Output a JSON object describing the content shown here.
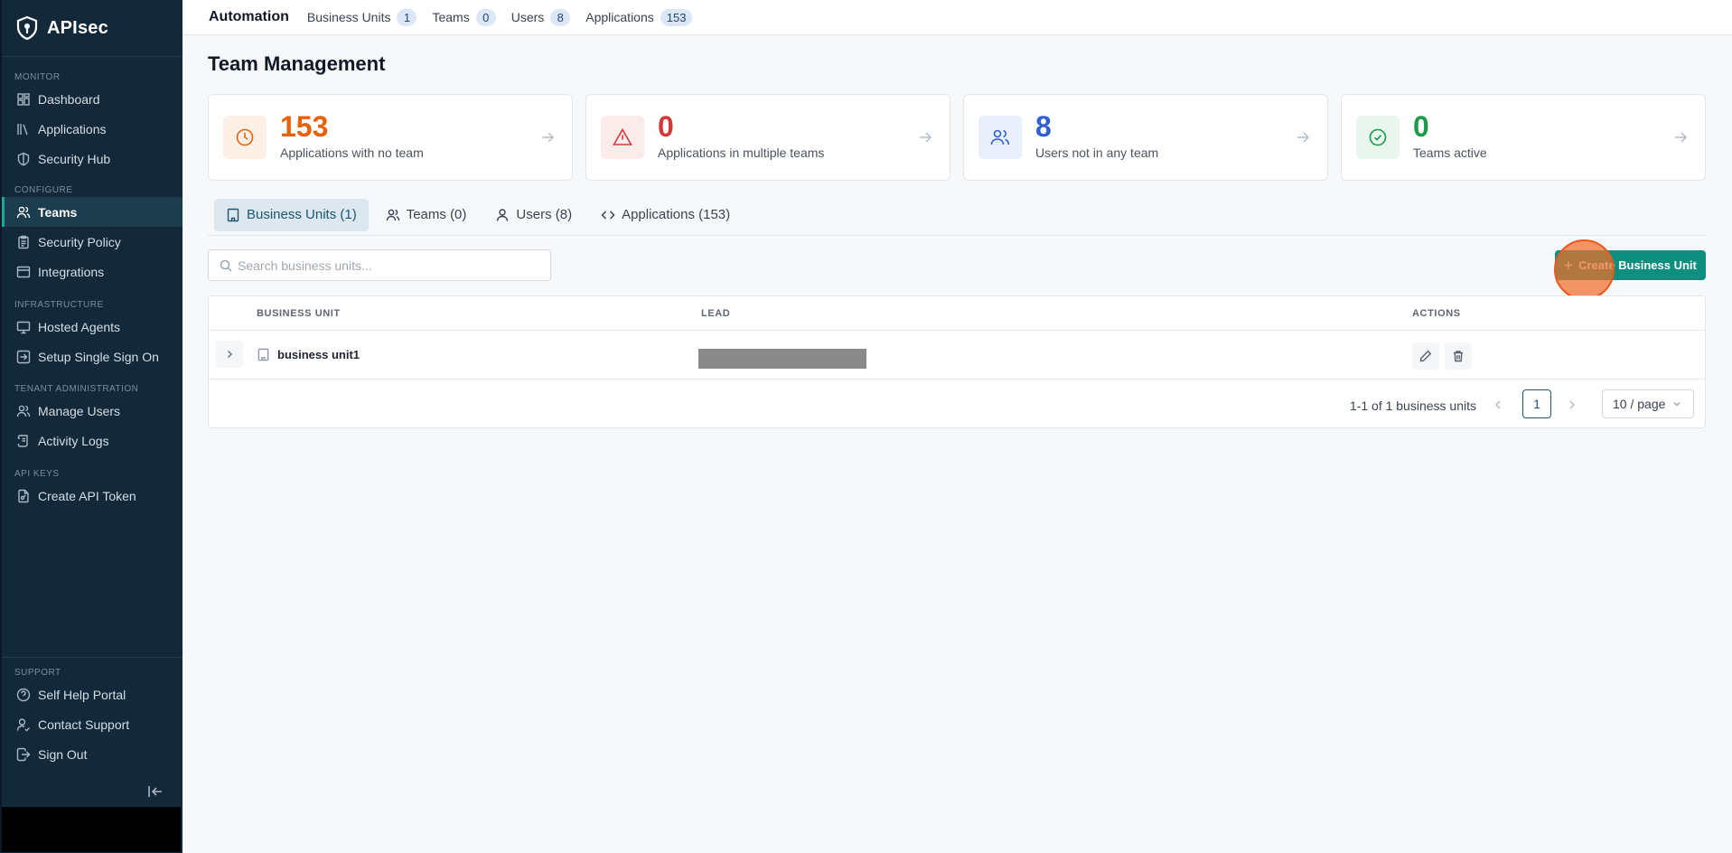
{
  "brand": {
    "name": "APIsec"
  },
  "sidebar": {
    "sections": [
      {
        "label": "MONITOR",
        "items": [
          {
            "label": "Dashboard",
            "icon": "dashboard-icon"
          },
          {
            "label": "Applications",
            "icon": "applications-icon"
          },
          {
            "label": "Security Hub",
            "icon": "shield-icon"
          }
        ]
      },
      {
        "label": "CONFIGURE",
        "items": [
          {
            "label": "Teams",
            "icon": "users-icon",
            "active": true
          },
          {
            "label": "Security Policy",
            "icon": "clipboard-icon"
          },
          {
            "label": "Integrations",
            "icon": "window-icon"
          }
        ]
      },
      {
        "label": "INFRASTRUCTURE",
        "items": [
          {
            "label": "Hosted Agents",
            "icon": "monitor-icon"
          },
          {
            "label": "Setup Single Sign On",
            "icon": "login-icon"
          }
        ]
      },
      {
        "label": "TENANT ADMINISTRATION",
        "items": [
          {
            "label": "Manage Users",
            "icon": "users-icon"
          },
          {
            "label": "Activity Logs",
            "icon": "scroll-icon"
          }
        ]
      },
      {
        "label": "API KEYS",
        "items": [
          {
            "label": "Create API Token",
            "icon": "file-key-icon"
          }
        ]
      }
    ],
    "support": {
      "label": "SUPPORT",
      "items": [
        {
          "label": "Self Help Portal",
          "icon": "help-circle-icon"
        },
        {
          "label": "Contact Support",
          "icon": "contact-icon"
        },
        {
          "label": "Sign Out",
          "icon": "sign-out-icon"
        }
      ]
    }
  },
  "topbar": {
    "title": "Automation",
    "stats": [
      {
        "label": "Business Units",
        "count": "1"
      },
      {
        "label": "Teams",
        "count": "0"
      },
      {
        "label": "Users",
        "count": "8"
      },
      {
        "label": "Applications",
        "count": "153"
      }
    ]
  },
  "page": {
    "title": "Team Management"
  },
  "cards": [
    {
      "value": "153",
      "label": "Applications with no team",
      "icon": "clock-icon",
      "color": "#e8620c",
      "bg": "#fdf0e6"
    },
    {
      "value": "0",
      "label": "Applications in multiple teams",
      "icon": "alert-triangle-icon",
      "color": "#d23a3a",
      "bg": "#fcebeb"
    },
    {
      "value": "8",
      "label": "Users not in any team",
      "icon": "users-icon",
      "color": "#2f5fd0",
      "bg": "#e9f0fc"
    },
    {
      "value": "0",
      "label": "Teams active",
      "icon": "check-circle-icon",
      "color": "#1f9a4c",
      "bg": "#e8f6ee"
    }
  ],
  "tabs": [
    {
      "label": "Business Units (1)",
      "icon": "building-icon",
      "active": true
    },
    {
      "label": "Teams (0)",
      "icon": "users-icon"
    },
    {
      "label": "Users (8)",
      "icon": "user-icon"
    },
    {
      "label": "Applications (153)",
      "icon": "code-icon"
    }
  ],
  "search": {
    "placeholder": "Search business units...",
    "value": ""
  },
  "create_button": {
    "label": "Create Business Unit"
  },
  "table": {
    "columns": [
      "BUSINESS UNIT",
      "LEAD",
      "ACTIONS"
    ],
    "rows": [
      {
        "name": "business unit1",
        "lead": ""
      }
    ]
  },
  "pagination": {
    "info": "1-1 of 1 business units",
    "current_page": "1",
    "page_size": "10 / page"
  },
  "colors": {
    "sidebar_bg": "#13293a",
    "accent": "#0e8f7e",
    "active_tab": "#1a5770"
  }
}
